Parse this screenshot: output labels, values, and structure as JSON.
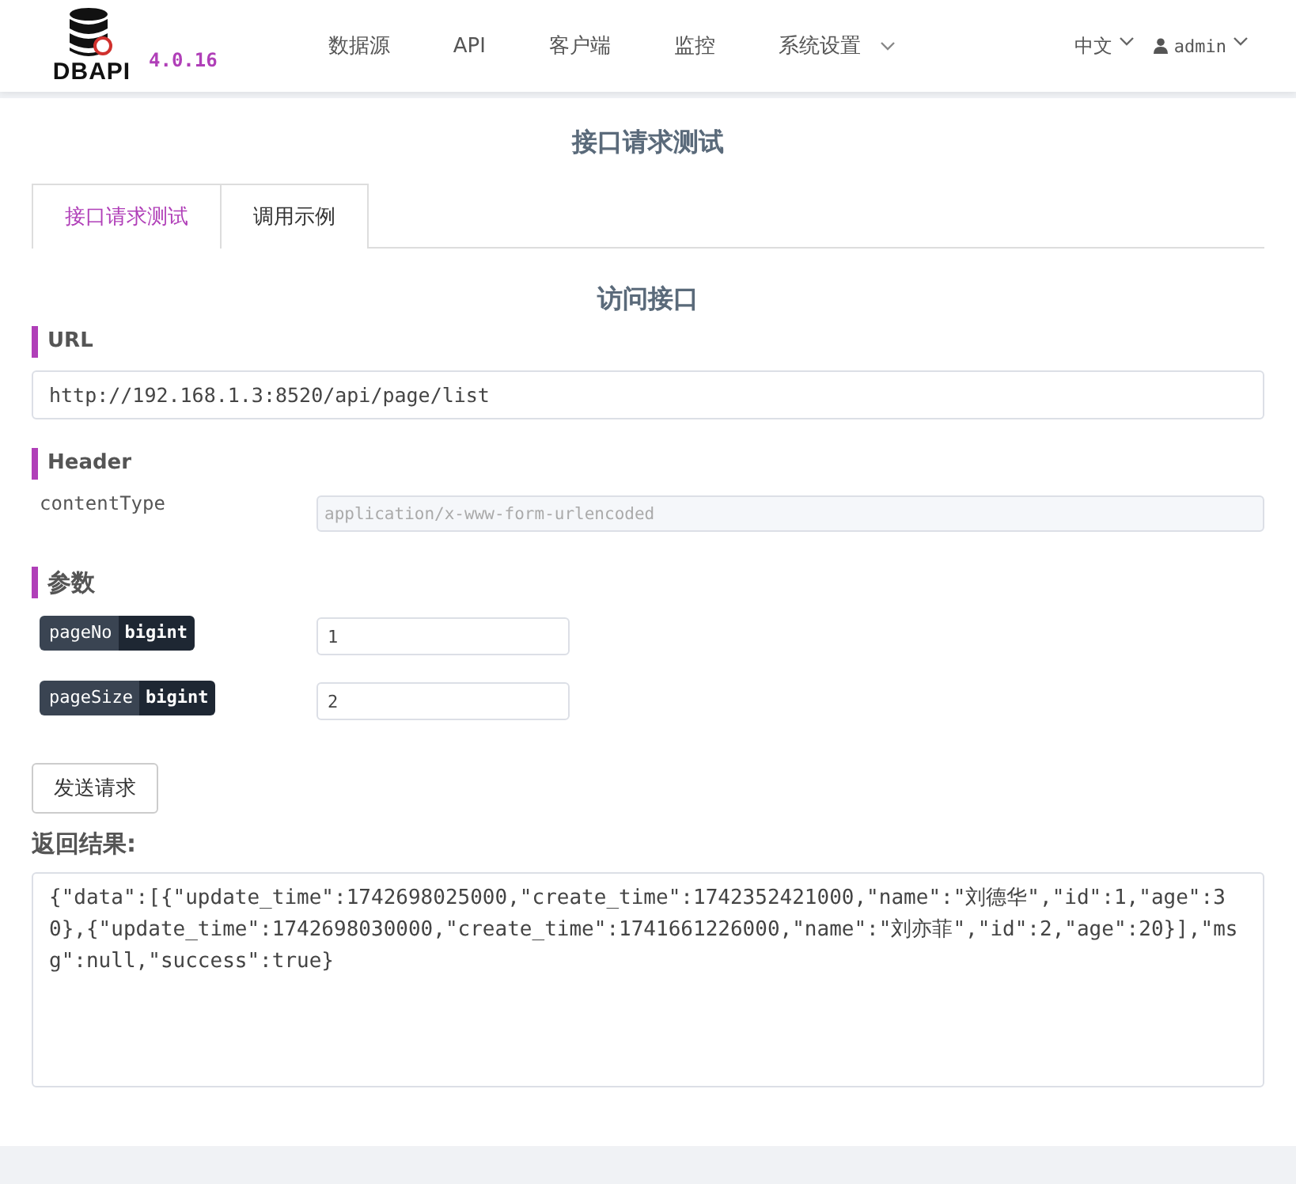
{
  "logo": {
    "text": "DBAPI",
    "version": "4.0.16"
  },
  "nav": [
    {
      "label": "数据源",
      "dropdown": false
    },
    {
      "label": "API",
      "dropdown": false
    },
    {
      "label": "客户端",
      "dropdown": false
    },
    {
      "label": "监控",
      "dropdown": false
    },
    {
      "label": "系统设置",
      "dropdown": true
    }
  ],
  "language": "中文",
  "user": "admin",
  "page_title": "接口请求测试",
  "tabs": [
    {
      "label": "接口请求测试",
      "selected": true
    },
    {
      "label": "调用示例",
      "selected": false
    }
  ],
  "section_title": "访问接口",
  "url": {
    "heading": "URL",
    "value": "http://192.168.1.3:8520/api/page/list"
  },
  "header": {
    "heading": "Header",
    "rows": [
      {
        "name": "contentType",
        "placeholder": "application/x-www-form-urlencoded"
      }
    ]
  },
  "params": {
    "heading": "参数",
    "rows": [
      {
        "name": "pageNo",
        "type": "bigint",
        "value": "1"
      },
      {
        "name": "pageSize",
        "type": "bigint",
        "value": "2"
      }
    ]
  },
  "send_button": "发送请求",
  "result": {
    "heading": "返回结果:",
    "value": "{\"data\":[{\"update_time\":1742698025000,\"create_time\":1742352421000,\"name\":\"刘德华\",\"id\":1,\"age\":30},{\"update_time\":1742698030000,\"create_time\":1741661226000,\"name\":\"刘亦菲\",\"id\":2,\"age\":20}],\"msg\":null,\"success\":true}"
  }
}
